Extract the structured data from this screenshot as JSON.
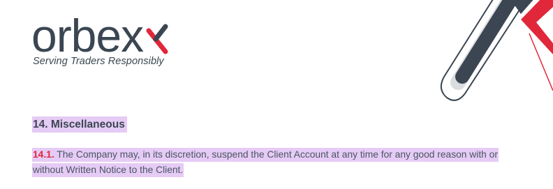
{
  "brand": {
    "name": "orbex",
    "tagline": "Serving Traders Responsibly",
    "colors": {
      "text_dark": "#3b4652",
      "accent_red": "#e0283a",
      "highlight": "#e5cbf5"
    }
  },
  "section": {
    "heading": "14. Miscellaneous"
  },
  "clause": {
    "number": "14.1.",
    "text": "The Company may, in its discretion, suspend the Client Account at any time for any good reason with or without Written Notice to the Client."
  }
}
